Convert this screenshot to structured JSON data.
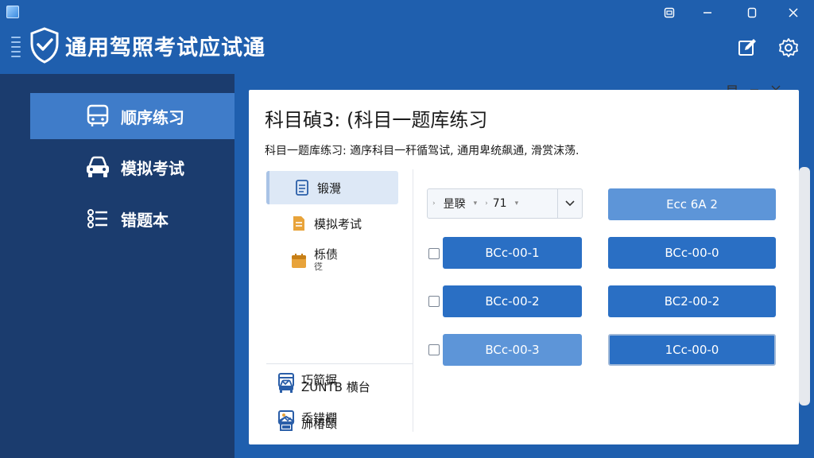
{
  "app": {
    "title": "通用驾照考试应试通"
  },
  "sidebar": {
    "items": [
      {
        "label": "顺序练习",
        "icon": "bus-icon",
        "active": true
      },
      {
        "label": "模拟考试",
        "icon": "car-icon",
        "active": false
      },
      {
        "label": "错题本",
        "icon": "list-icon",
        "active": false
      }
    ]
  },
  "panel": {
    "title": "科目碵3: (科目一题库练习",
    "description": "科目一题库练习: 適序科目一秆循驾试, 通用卑统飙通, 滑赏沫荡.",
    "categories": [
      {
        "label": "锻灚",
        "icon": "document-icon",
        "active": true
      },
      {
        "label": "模拟考试",
        "icon": "exam-paper-icon",
        "active": false
      },
      {
        "label": "栎债",
        "sublabel": "徔",
        "icon": "calendar-icon",
        "active": false
      },
      {
        "label": "ZUNTB 横台",
        "icon": "car-icon",
        "active": false
      },
      {
        "label": "斾椿頣",
        "icon": "garage-icon",
        "active": false
      },
      {
        "label": "巧箭摒",
        "icon": "calendar-check-icon",
        "active": false
      },
      {
        "label": "岙错橺",
        "icon": "image-icon",
        "active": false
      }
    ],
    "filter": {
      "first": "昰聧",
      "second": "71"
    },
    "questions": [
      {
        "label": "Ecc 6A 2",
        "style": "light",
        "checkbox": false
      },
      {
        "label": "BCc-00-1",
        "style": "solid",
        "checkbox": true
      },
      {
        "label": "BCc-00-0",
        "style": "solid",
        "checkbox": false
      },
      {
        "label": "BCc-00-2",
        "style": "solid",
        "checkbox": true
      },
      {
        "label": "BC2-00-2",
        "style": "solid",
        "checkbox": false
      },
      {
        "label": "BCc-00-3",
        "style": "light",
        "checkbox": true
      },
      {
        "label": "1Cc-00-0",
        "style": "outlined",
        "checkbox": false
      }
    ]
  },
  "colors": {
    "header_bg": "#1f5fae",
    "sidebar_bg": "#1b3c6e",
    "sidebar_active": "#3f7cc9",
    "button_primary": "#2a6fc4",
    "button_light": "#5d95d8",
    "icon_orange": "#e8a33a"
  }
}
